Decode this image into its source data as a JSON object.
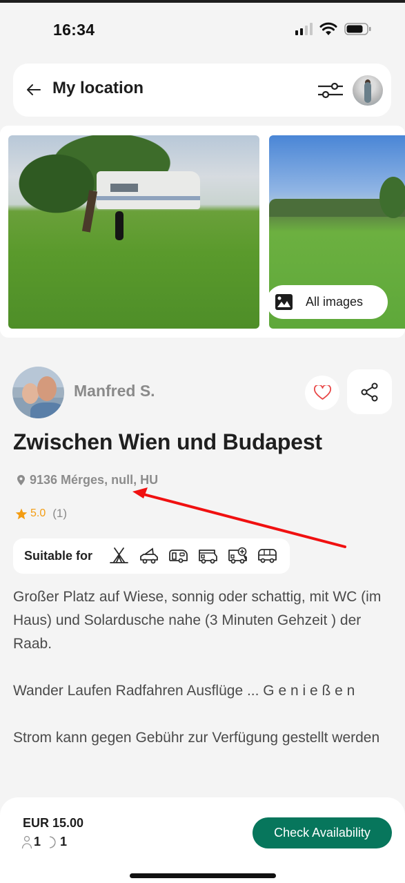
{
  "status_bar": {
    "time": "16:34",
    "signal_bars_active": 2,
    "signal_bars_total": 4,
    "icons": [
      "signal-icon",
      "wifi-icon",
      "battery-icon"
    ]
  },
  "header": {
    "back_icon": "arrow-left-icon",
    "title": "My location",
    "filter_icon": "sliders-icon",
    "profile_avatar": "user-avatar"
  },
  "gallery": {
    "photos": [
      {
        "description": "Motorhome parked on grass under a tree, black dog"
      },
      {
        "description": "Green meadow with young trees and blue sky"
      }
    ],
    "all_images_icon": "image-icon",
    "all_images_label": "All images"
  },
  "host": {
    "name": "Manfred S.",
    "favorite_icon": "heart-icon",
    "share_icon": "share-icon"
  },
  "listing": {
    "title": "Zwischen Wien und Budapest",
    "location_icon": "map-pin-icon",
    "location": "9136 Mérges, null, HU",
    "rating": "5.0",
    "rating_count": "(1)",
    "rating_icon": "star-icon",
    "accent_color": "#f39c12"
  },
  "suitable_for": {
    "label": "Suitable for",
    "icons": [
      "tent-icon",
      "rooftop-tent-car-icon",
      "caravan-icon",
      "motorhome-icon",
      "motorhome-plus-icon",
      "campervan-icon"
    ]
  },
  "description": {
    "paragraphs": [
      "Großer Platz auf Wiese, sonnig oder schattig, mit WC (im Haus) und Solardusche nahe (3 Minuten Gehzeit ) der Raab.",
      "Wander Laufen Radfahren Ausflüge ... G e n i e ß e n",
      "Strom kann gegen Gebühr zur Verfügung gestellt werden"
    ]
  },
  "booking": {
    "price": "EUR 15.00",
    "guests": "1",
    "nights": "1",
    "guest_icon": "person-icon",
    "night_icon": "moon-icon",
    "cta_label": "Check Availability",
    "cta_color": "#07765c"
  },
  "annotation": {
    "type": "red-arrow",
    "color": "#f01010",
    "points_to": "location"
  }
}
